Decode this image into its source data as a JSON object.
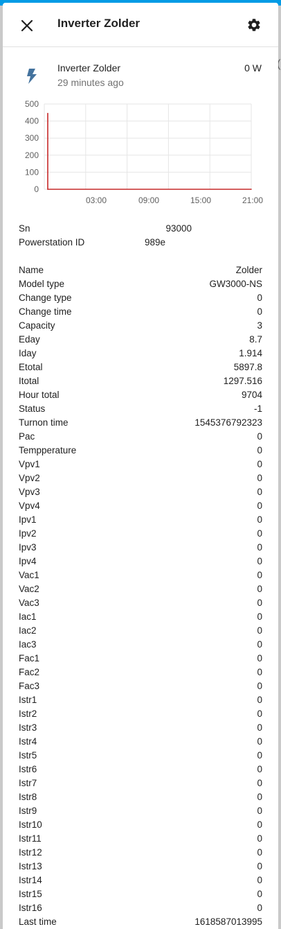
{
  "dialog": {
    "title": "Inverter Zolder",
    "close_icon": "close-icon",
    "settings_icon": "gear-icon"
  },
  "entity": {
    "icon": "lightning-bolt-icon",
    "icon_color": "#44739e",
    "name": "Inverter Zolder",
    "last_changed": "29 minutes ago",
    "state": "0 W"
  },
  "chart_data": {
    "type": "line",
    "y_ticks": [
      "500",
      "400",
      "300",
      "200",
      "100",
      "0"
    ],
    "x_ticks": [
      "03:00",
      "09:00",
      "15:00",
      "21:00"
    ],
    "ylim": [
      0,
      500
    ],
    "grid": true,
    "line_color": "#c62828",
    "series": [
      {
        "x": [
          "start",
          "start",
          "end"
        ],
        "values": [
          445,
          0,
          0
        ]
      }
    ]
  },
  "info_attributes": [
    {
      "key": "Sn",
      "value": "93000"
    },
    {
      "key": "Powerstation ID",
      "value": "989е"
    }
  ],
  "attributes": [
    {
      "key": "Name",
      "value": "Zolder"
    },
    {
      "key": "Model type",
      "value": "GW3000-NS"
    },
    {
      "key": "Change type",
      "value": "0"
    },
    {
      "key": "Change time",
      "value": "0"
    },
    {
      "key": "Capacity",
      "value": "3"
    },
    {
      "key": "Eday",
      "value": "8.7"
    },
    {
      "key": "Iday",
      "value": "1.914"
    },
    {
      "key": "Etotal",
      "value": "5897.8"
    },
    {
      "key": "Itotal",
      "value": "1297.516"
    },
    {
      "key": "Hour total",
      "value": "9704"
    },
    {
      "key": "Status",
      "value": "-1"
    },
    {
      "key": "Turnon time",
      "value": "1545376792323"
    },
    {
      "key": "Pac",
      "value": "0"
    },
    {
      "key": "Tempperature",
      "value": "0"
    },
    {
      "key": "Vpv1",
      "value": "0"
    },
    {
      "key": "Vpv2",
      "value": "0"
    },
    {
      "key": "Vpv3",
      "value": "0"
    },
    {
      "key": "Vpv4",
      "value": "0"
    },
    {
      "key": "Ipv1",
      "value": "0"
    },
    {
      "key": "Ipv2",
      "value": "0"
    },
    {
      "key": "Ipv3",
      "value": "0"
    },
    {
      "key": "Ipv4",
      "value": "0"
    },
    {
      "key": "Vac1",
      "value": "0"
    },
    {
      "key": "Vac2",
      "value": "0"
    },
    {
      "key": "Vac3",
      "value": "0"
    },
    {
      "key": "Iac1",
      "value": "0"
    },
    {
      "key": "Iac2",
      "value": "0"
    },
    {
      "key": "Iac3",
      "value": "0"
    },
    {
      "key": "Fac1",
      "value": "0"
    },
    {
      "key": "Fac2",
      "value": "0"
    },
    {
      "key": "Fac3",
      "value": "0"
    },
    {
      "key": "Istr1",
      "value": "0"
    },
    {
      "key": "Istr2",
      "value": "0"
    },
    {
      "key": "Istr3",
      "value": "0"
    },
    {
      "key": "Istr4",
      "value": "0"
    },
    {
      "key": "Istr5",
      "value": "0"
    },
    {
      "key": "Istr6",
      "value": "0"
    },
    {
      "key": "Istr7",
      "value": "0"
    },
    {
      "key": "Istr8",
      "value": "0"
    },
    {
      "key": "Istr9",
      "value": "0"
    },
    {
      "key": "Istr10",
      "value": "0"
    },
    {
      "key": "Istr11",
      "value": "0"
    },
    {
      "key": "Istr12",
      "value": "0"
    },
    {
      "key": "Istr13",
      "value": "0"
    },
    {
      "key": "Istr14",
      "value": "0"
    },
    {
      "key": "Istr15",
      "value": "0"
    },
    {
      "key": "Istr16",
      "value": "0"
    },
    {
      "key": "Last time",
      "value": "1618587013995"
    }
  ]
}
